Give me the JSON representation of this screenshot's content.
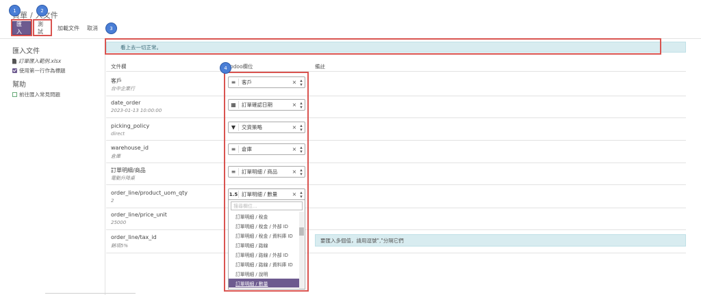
{
  "header": {
    "breadcrumb_1": "資單",
    "breadcrumb_2": "人文件",
    "import_label": "匯入",
    "test_label": "測試",
    "load_file_label": "加載文件",
    "cancel_label": "取消"
  },
  "markers": [
    "1",
    "2",
    "3",
    "4"
  ],
  "sidebar": {
    "files_heading": "匯入文件",
    "file_name": "訂單匯入範例.xlsx",
    "first_row_header": "使用第一行作為標題",
    "help_heading": "幫助",
    "faq_link": "前往匯入常見問題"
  },
  "main": {
    "alert": "看上去一切正常。",
    "col_file": "文件欄",
    "col_odoo": "odoo欄位",
    "col_note": "備註",
    "rows": [
      {
        "name": "客戶",
        "sample": "台中企業行",
        "icon": "≡",
        "field": "客戶"
      },
      {
        "name": "date_order",
        "sample": "2023-01-13 10:00:00",
        "icon": "▦",
        "field": "訂單確認日期"
      },
      {
        "name": "picking_policy",
        "sample": "direct",
        "icon": "▼",
        "field": "交貨策略"
      },
      {
        "name": "warehouse_id",
        "sample": "倉庫",
        "icon": "≡",
        "field": "倉庫"
      },
      {
        "name": "訂單明細/商品",
        "sample": "電動升降桌",
        "icon": "≡",
        "field": "訂單明細 / 商品"
      },
      {
        "name": "order_line/product_uom_qty",
        "sample": "2",
        "icon": "1.5",
        "field": "訂單明細 / 數量"
      },
      {
        "name": "order_line/price_unit",
        "sample": "25000",
        "icon": "",
        "field": ""
      },
      {
        "name": "order_line/tax_id",
        "sample": "銷項5%",
        "icon": "",
        "field": ""
      }
    ],
    "dropdown": {
      "search_placeholder": "搜尋欄位...",
      "options": [
        "訂單明細 / 稅金",
        "訂單明細 / 稅金 / 外部 ID",
        "訂單明細 / 稅金 / 資料庫 ID",
        "訂單明細 / 路線",
        "訂單明細 / 路線 / 外部 ID",
        "訂單明細 / 路線 / 資料庫 ID",
        "訂單明細 / 說明",
        "訂單明細 / 數量"
      ],
      "selected": "訂單明細 / 數量"
    },
    "tax_hint": "要匯入多個值，請用逗號\",\"分隔它們"
  }
}
